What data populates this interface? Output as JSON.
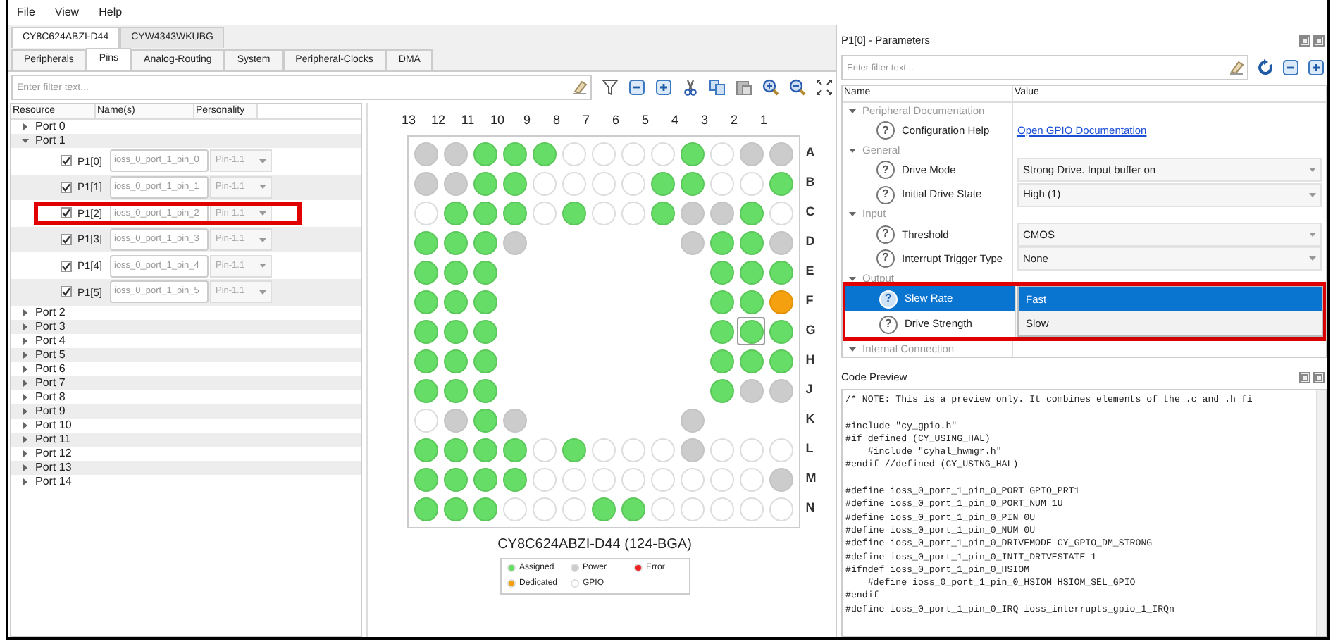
{
  "menu": [
    "File",
    "View",
    "Help"
  ],
  "device_tabs": [
    {
      "label": "CY8C624ABZI-D44",
      "selected": true
    },
    {
      "label": "CYW4343WKUBG",
      "selected": false
    }
  ],
  "tabs": [
    {
      "label": "Peripherals",
      "selected": false
    },
    {
      "label": "Pins",
      "selected": true
    },
    {
      "label": "Analog-Routing",
      "selected": false
    },
    {
      "label": "System",
      "selected": false
    },
    {
      "label": "Peripheral-Clocks",
      "selected": false
    },
    {
      "label": "DMA",
      "selected": false
    }
  ],
  "filter": {
    "placeholder": "Enter filter text..."
  },
  "tree": {
    "columns": [
      "Resource",
      "Name(s)",
      "Personality"
    ],
    "items": [
      {
        "label": "Port 0",
        "expanded": false
      },
      {
        "label": "Port 1",
        "expanded": true,
        "children": [
          {
            "label": "P1[0]",
            "checked": true,
            "name": "ioss_0_port_1_pin_0",
            "personality": "Pin-1.1",
            "highlighted": false
          },
          {
            "label": "P1[1]",
            "checked": true,
            "name": "ioss_0_port_1_pin_1",
            "personality": "Pin-1.1",
            "highlighted": false
          },
          {
            "label": "P1[2]",
            "checked": true,
            "name": "ioss_0_port_1_pin_2",
            "personality": "Pin-1.1",
            "highlighted": true
          },
          {
            "label": "P1[3]",
            "checked": true,
            "name": "ioss_0_port_1_pin_3",
            "personality": "Pin-1.1",
            "highlighted": false
          },
          {
            "label": "P1[4]",
            "checked": true,
            "name": "ioss_0_port_1_pin_4",
            "personality": "Pin-1.1",
            "highlighted": false
          },
          {
            "label": "P1[5]",
            "checked": true,
            "name": "ioss_0_port_1_pin_5",
            "personality": "Pin-1.1",
            "highlighted": false
          }
        ]
      },
      {
        "label": "Port 2",
        "expanded": false
      },
      {
        "label": "Port 3",
        "expanded": false
      },
      {
        "label": "Port 4",
        "expanded": false
      },
      {
        "label": "Port 5",
        "expanded": false
      },
      {
        "label": "Port 6",
        "expanded": false
      },
      {
        "label": "Port 7",
        "expanded": false
      },
      {
        "label": "Port 8",
        "expanded": false
      },
      {
        "label": "Port 9",
        "expanded": false
      },
      {
        "label": "Port 10",
        "expanded": false
      },
      {
        "label": "Port 11",
        "expanded": false
      },
      {
        "label": "Port 12",
        "expanded": false
      },
      {
        "label": "Port 13",
        "expanded": false
      },
      {
        "label": "Port 14",
        "expanded": false
      }
    ]
  },
  "pin_map": {
    "columns": [
      "13",
      "12",
      "11",
      "10",
      "9",
      "8",
      "7",
      "6",
      "5",
      "4",
      "3",
      "2",
      "1"
    ],
    "rows": [
      {
        "letter": "A",
        "balls": [
          {
            "kind": "power",
            "selected": false
          },
          {
            "kind": "power",
            "selected": false
          },
          {
            "kind": "assigned",
            "selected": false
          },
          {
            "kind": "assigned",
            "selected": false
          },
          {
            "kind": "assigned",
            "selected": false
          },
          {
            "kind": "gpio",
            "selected": false
          },
          {
            "kind": "gpio",
            "selected": false
          },
          {
            "kind": "gpio",
            "selected": false
          },
          {
            "kind": "gpio",
            "selected": false
          },
          {
            "kind": "assigned",
            "selected": false
          },
          {
            "kind": "gpio",
            "selected": false
          },
          {
            "kind": "power",
            "selected": false
          },
          {
            "kind": "power",
            "selected": false
          }
        ]
      },
      {
        "letter": "B",
        "balls": [
          {
            "kind": "power",
            "selected": false
          },
          {
            "kind": "power",
            "selected": false
          },
          {
            "kind": "assigned",
            "selected": false
          },
          {
            "kind": "assigned",
            "selected": false
          },
          {
            "kind": "gpio",
            "selected": false
          },
          {
            "kind": "gpio",
            "selected": false
          },
          {
            "kind": "gpio",
            "selected": false
          },
          {
            "kind": "gpio",
            "selected": false
          },
          {
            "kind": "assigned",
            "selected": false
          },
          {
            "kind": "assigned",
            "selected": false
          },
          {
            "kind": "gpio",
            "selected": false
          },
          {
            "kind": "gpio",
            "selected": false
          },
          {
            "kind": "assigned",
            "selected": false
          }
        ]
      },
      {
        "letter": "C",
        "balls": [
          {
            "kind": "gpio",
            "selected": false
          },
          {
            "kind": "assigned",
            "selected": false
          },
          {
            "kind": "assigned",
            "selected": false
          },
          {
            "kind": "assigned",
            "selected": false
          },
          {
            "kind": "gpio",
            "selected": false
          },
          {
            "kind": "assigned",
            "selected": false
          },
          {
            "kind": "gpio",
            "selected": false
          },
          {
            "kind": "gpio",
            "selected": false
          },
          {
            "kind": "assigned",
            "selected": false
          },
          {
            "kind": "power",
            "selected": false
          },
          {
            "kind": "power",
            "selected": false
          },
          {
            "kind": "assigned",
            "selected": false
          },
          {
            "kind": "gpio",
            "selected": false
          }
        ]
      },
      {
        "letter": "D",
        "balls": [
          {
            "kind": "assigned",
            "selected": false
          },
          {
            "kind": "assigned",
            "selected": false
          },
          {
            "kind": "assigned",
            "selected": false
          },
          {
            "kind": "power",
            "selected": false
          },
          {
            "kind": "none"
          },
          {
            "kind": "none"
          },
          {
            "kind": "none"
          },
          {
            "kind": "none"
          },
          {
            "kind": "none"
          },
          {
            "kind": "power",
            "selected": false
          },
          {
            "kind": "assigned",
            "selected": false
          },
          {
            "kind": "assigned",
            "selected": false
          },
          {
            "kind": "power",
            "selected": false
          }
        ]
      },
      {
        "letter": "E",
        "balls": [
          {
            "kind": "assigned",
            "selected": false
          },
          {
            "kind": "assigned",
            "selected": false
          },
          {
            "kind": "assigned",
            "selected": false
          },
          {
            "kind": "none"
          },
          {
            "kind": "none"
          },
          {
            "kind": "none"
          },
          {
            "kind": "none"
          },
          {
            "kind": "none"
          },
          {
            "kind": "none"
          },
          {
            "kind": "none"
          },
          {
            "kind": "assigned",
            "selected": false
          },
          {
            "kind": "assigned",
            "selected": false
          },
          {
            "kind": "assigned",
            "selected": false
          }
        ]
      },
      {
        "letter": "F",
        "balls": [
          {
            "kind": "assigned",
            "selected": false
          },
          {
            "kind": "assigned",
            "selected": false
          },
          {
            "kind": "assigned",
            "selected": false
          },
          {
            "kind": "none"
          },
          {
            "kind": "none"
          },
          {
            "kind": "none"
          },
          {
            "kind": "none"
          },
          {
            "kind": "none"
          },
          {
            "kind": "none"
          },
          {
            "kind": "none"
          },
          {
            "kind": "assigned",
            "selected": false
          },
          {
            "kind": "assigned",
            "selected": false
          },
          {
            "kind": "dedicated",
            "selected": false
          }
        ]
      },
      {
        "letter": "G",
        "balls": [
          {
            "kind": "assigned",
            "selected": false
          },
          {
            "kind": "assigned",
            "selected": false
          },
          {
            "kind": "assigned",
            "selected": false
          },
          {
            "kind": "none"
          },
          {
            "kind": "none"
          },
          {
            "kind": "none"
          },
          {
            "kind": "none"
          },
          {
            "kind": "none"
          },
          {
            "kind": "none"
          },
          {
            "kind": "none"
          },
          {
            "kind": "assigned",
            "selected": false
          },
          {
            "kind": "assigned",
            "selected": true
          },
          {
            "kind": "assigned",
            "selected": false
          }
        ]
      },
      {
        "letter": "H",
        "balls": [
          {
            "kind": "assigned",
            "selected": false
          },
          {
            "kind": "assigned",
            "selected": false
          },
          {
            "kind": "assigned",
            "selected": false
          },
          {
            "kind": "none"
          },
          {
            "kind": "none"
          },
          {
            "kind": "none"
          },
          {
            "kind": "none"
          },
          {
            "kind": "none"
          },
          {
            "kind": "none"
          },
          {
            "kind": "none"
          },
          {
            "kind": "assigned",
            "selected": false
          },
          {
            "kind": "assigned",
            "selected": false
          },
          {
            "kind": "assigned",
            "selected": false
          }
        ]
      },
      {
        "letter": "J",
        "balls": [
          {
            "kind": "assigned",
            "selected": false
          },
          {
            "kind": "assigned",
            "selected": false
          },
          {
            "kind": "assigned",
            "selected": false
          },
          {
            "kind": "none"
          },
          {
            "kind": "none"
          },
          {
            "kind": "none"
          },
          {
            "kind": "none"
          },
          {
            "kind": "none"
          },
          {
            "kind": "none"
          },
          {
            "kind": "none"
          },
          {
            "kind": "assigned",
            "selected": false
          },
          {
            "kind": "power",
            "selected": false
          },
          {
            "kind": "power",
            "selected": false
          }
        ]
      },
      {
        "letter": "K",
        "balls": [
          {
            "kind": "gpio",
            "selected": false
          },
          {
            "kind": "power",
            "selected": false
          },
          {
            "kind": "assigned",
            "selected": false
          },
          {
            "kind": "power",
            "selected": false
          },
          {
            "kind": "none"
          },
          {
            "kind": "none"
          },
          {
            "kind": "none"
          },
          {
            "kind": "none"
          },
          {
            "kind": "none"
          },
          {
            "kind": "power",
            "selected": false
          },
          {
            "kind": "none"
          },
          {
            "kind": "none"
          },
          {
            "kind": "none"
          }
        ]
      },
      {
        "letter": "L",
        "balls": [
          {
            "kind": "assigned",
            "selected": false
          },
          {
            "kind": "assigned",
            "selected": false
          },
          {
            "kind": "assigned",
            "selected": false
          },
          {
            "kind": "assigned",
            "selected": false
          },
          {
            "kind": "gpio",
            "selected": false
          },
          {
            "kind": "assigned",
            "selected": false
          },
          {
            "kind": "gpio",
            "selected": false
          },
          {
            "kind": "gpio",
            "selected": false
          },
          {
            "kind": "gpio",
            "selected": false
          },
          {
            "kind": "power",
            "selected": false
          },
          {
            "kind": "gpio",
            "selected": false
          },
          {
            "kind": "gpio",
            "selected": false
          },
          {
            "kind": "gpio",
            "selected": false
          }
        ]
      },
      {
        "letter": "M",
        "balls": [
          {
            "kind": "assigned",
            "selected": false
          },
          {
            "kind": "assigned",
            "selected": false
          },
          {
            "kind": "assigned",
            "selected": false
          },
          {
            "kind": "assigned",
            "selected": false
          },
          {
            "kind": "gpio",
            "selected": false
          },
          {
            "kind": "gpio",
            "selected": false
          },
          {
            "kind": "gpio",
            "selected": false
          },
          {
            "kind": "gpio",
            "selected": false
          },
          {
            "kind": "gpio",
            "selected": false
          },
          {
            "kind": "gpio",
            "selected": false
          },
          {
            "kind": "gpio",
            "selected": false
          },
          {
            "kind": "gpio",
            "selected": false
          },
          {
            "kind": "power",
            "selected": false
          }
        ]
      },
      {
        "letter": "N",
        "balls": [
          {
            "kind": "assigned",
            "selected": false
          },
          {
            "kind": "assigned",
            "selected": false
          },
          {
            "kind": "assigned",
            "selected": false
          },
          {
            "kind": "gpio",
            "selected": false
          },
          {
            "kind": "gpio",
            "selected": false
          },
          {
            "kind": "gpio",
            "selected": false
          },
          {
            "kind": "assigned",
            "selected": false
          },
          {
            "kind": "assigned",
            "selected": false
          },
          {
            "kind": "gpio",
            "selected": false
          },
          {
            "kind": "gpio",
            "selected": false
          },
          {
            "kind": "gpio",
            "selected": false
          },
          {
            "kind": "gpio",
            "selected": false
          },
          {
            "kind": "gpio",
            "selected": false
          }
        ]
      }
    ],
    "caption": "CY8C624ABZI-D44 (124-BGA)",
    "legend": [
      {
        "label": "Assigned",
        "color": "#66dd66"
      },
      {
        "label": "Power",
        "color": "#cccccc"
      },
      {
        "label": "Error",
        "color": "#ee2222"
      },
      {
        "label": "Dedicated",
        "color": "#f5a00f"
      },
      {
        "label": "GPIO",
        "color": "#ffffff"
      }
    ]
  },
  "parameters": {
    "title": "P1[0] - Parameters",
    "filter": {
      "placeholder": "Enter filter text..."
    },
    "columns": [
      "Name",
      "Value"
    ],
    "groups": [
      {
        "label": "Peripheral Documentation",
        "expanded": true,
        "params": [
          {
            "name": "Configuration Help",
            "help": "?",
            "kind": "link",
            "value": "Open GPIO Documentation",
            "selected": false,
            "highlighted": false
          }
        ]
      },
      {
        "label": "General",
        "expanded": true,
        "params": [
          {
            "name": "Drive Mode",
            "help": "?",
            "kind": "dropdown",
            "value": "Strong Drive. Input buffer on",
            "selected": false,
            "highlighted": false
          },
          {
            "name": "Initial Drive State",
            "help": "?",
            "kind": "dropdown",
            "value": "High (1)",
            "selected": false,
            "highlighted": false
          }
        ]
      },
      {
        "label": "Input",
        "expanded": true,
        "params": [
          {
            "name": "Threshold",
            "help": "?",
            "kind": "dropdown",
            "value": "CMOS",
            "selected": false,
            "highlighted": false
          },
          {
            "name": "Interrupt Trigger Type",
            "help": "?",
            "kind": "dropdown",
            "value": "None",
            "selected": false,
            "highlighted": false
          }
        ]
      },
      {
        "label": "Output",
        "expanded": true,
        "params": [
          {
            "name": "Slew Rate",
            "help": "?",
            "kind": "open-dropdown",
            "options": [
              {
                "label": "Fast",
                "selected": true
              },
              {
                "label": "Slow",
                "selected": false
              }
            ],
            "selected": true,
            "highlighted": true
          },
          {
            "name": "Drive Strength",
            "help": "?",
            "kind": "covered",
            "selected": false,
            "highlighted": true
          }
        ]
      },
      {
        "label": "Internal Connection",
        "expanded": true
      }
    ]
  },
  "code_preview": {
    "title": "Code Preview",
    "code": "/* NOTE: This is a preview only. It combines elements of the .c and .h fi\n\n#include \"cy_gpio.h\"\n#if defined (CY_USING_HAL)\n    #include \"cyhal_hwmgr.h\"\n#endif //defined (CY_USING_HAL)\n\n#define ioss_0_port_1_pin_0_PORT GPIO_PRT1\n#define ioss_0_port_1_pin_0_PORT_NUM 1U\n#define ioss_0_port_1_pin_0_PIN 0U\n#define ioss_0_port_1_pin_0_NUM 0U\n#define ioss_0_port_1_pin_0_DRIVEMODE CY_GPIO_DM_STRONG\n#define ioss_0_port_1_pin_0_INIT_DRIVESTATE 1\n#ifndef ioss_0_port_1_pin_0_HSIOM\n    #define ioss_0_port_1_pin_0_HSIOM HSIOM_SEL_GPIO\n#endif\n#define ioss_0_port_1_pin_0_IRQ ioss_interrupts_gpio_1_IRQn"
  }
}
